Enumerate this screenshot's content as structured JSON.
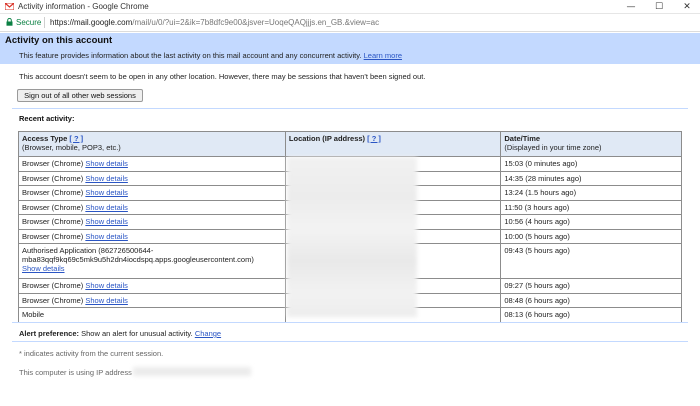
{
  "window": {
    "title": "Activity information - Google Chrome",
    "minimize": "—",
    "maximize": "☐",
    "close": "✕"
  },
  "address": {
    "secure_label": "Secure",
    "url_host": "https://mail.google.com",
    "url_rest": "/mail/u/0/?ui=2&ik=7b8dfc9e00&jsver=UoqeQAQjjjs.en_GB.&view=ac"
  },
  "header": {
    "title": "Activity on this account",
    "description": "This feature provides information about the last activity on this mail account and any concurrent activity.",
    "learn_more": "Learn more"
  },
  "note": "This account doesn't seem to be open in any other location. However, there may be sessions that haven't been signed out.",
  "signout_button": "Sign out of all other web sessions",
  "recent_label": "Recent activity:",
  "table": {
    "col1_title": "Access Type",
    "col1_sub": "(Browser, mobile, POP3, etc.)",
    "col2_title": "Location (IP address)",
    "col3_title": "Date/Time",
    "col3_sub": "(Displayed in your time zone)",
    "help_link": "[ ? ]",
    "show_details": "Show details",
    "rows": [
      {
        "type": "Browser (Chrome)",
        "time": "15:03 (0 minutes ago)"
      },
      {
        "type": "Browser (Chrome)",
        "time": "14:35 (28 minutes ago)"
      },
      {
        "type": "Browser (Chrome)",
        "time": "13:24 (1.5 hours ago)"
      },
      {
        "type": "Browser (Chrome)",
        "time": "11:50 (3 hours ago)"
      },
      {
        "type": "Browser (Chrome)",
        "time": "10:56 (4 hours ago)"
      },
      {
        "type": "Browser (Chrome)",
        "time": "10:00 (5 hours ago)"
      },
      {
        "type": "Authorised Application (862726500644-mba83qqf9kq69c5mk9u5h2dn4iocdspq.apps.googleusercontent.com)",
        "time": "09:43 (5 hours ago)"
      },
      {
        "type": "Browser (Chrome)",
        "time": "09:27 (5 hours ago)"
      },
      {
        "type": "Browser (Chrome)",
        "time": "08:48 (6 hours ago)"
      },
      {
        "type": "Mobile",
        "time": "08:13 (6 hours ago)"
      }
    ]
  },
  "alert": {
    "label": "Alert preference:",
    "text": "Show an alert for unusual activity.",
    "change": "Change"
  },
  "footnote": "* indicates activity from the current session.",
  "ip_line": "This computer is using IP address",
  "colors": {
    "header_bg": "#c3d9ff",
    "link": "#2a55c4",
    "secure_green": "#0b8043",
    "table_header_bg": "#e0e9f5"
  }
}
